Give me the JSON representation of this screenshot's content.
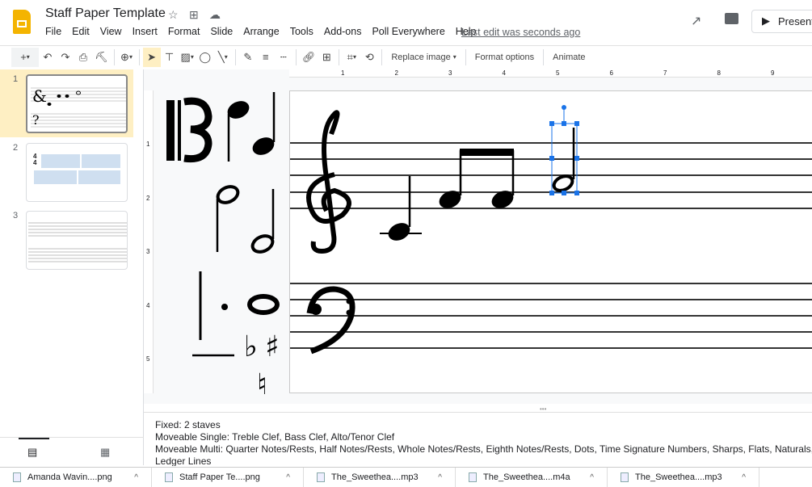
{
  "app": {
    "title": "Staff Paper Template",
    "icons": [
      "star-icon",
      "move-to-folder-icon",
      "cloud-saved-icon"
    ]
  },
  "menu": [
    "File",
    "Edit",
    "View",
    "Insert",
    "Format",
    "Slide",
    "Arrange",
    "Tools",
    "Add-ons",
    "Poll Everywhere",
    "Help"
  ],
  "last_edit": "Last edit was seconds ago",
  "header_right": {
    "present_label": "Present"
  },
  "toolbar": {
    "replace_image": "Replace image",
    "format_options": "Format options",
    "animate": "Animate"
  },
  "slides": [
    {
      "number": "1"
    },
    {
      "number": "2"
    },
    {
      "number": "3"
    }
  ],
  "ruler": {
    "top": [
      "1",
      "2",
      "3",
      "4",
      "5",
      "6",
      "7",
      "8",
      "9"
    ],
    "left": [
      "1",
      "2",
      "3",
      "4",
      "5"
    ]
  },
  "notes": [
    "Fixed:  2 staves",
    "Moveable Single:  Treble Clef, Bass Clef, Alto/Tenor Clef",
    "Moveable Multi:  Quarter Notes/Rests, Half Notes/Rests, Whole Notes/Rests, Eighth Notes/Rests, Dots, Time Signature Numbers, Sharps, Flats, Naturals,",
    "Ledger Lines"
  ],
  "downloads": [
    {
      "name": "Amanda Wavin....png"
    },
    {
      "name": "Staff Paper Te....png"
    },
    {
      "name": "The_Sweethea....mp3"
    },
    {
      "name": "The_Sweethea....m4a"
    },
    {
      "name": "The_Sweethea....mp3"
    }
  ],
  "colors": {
    "accent": "#f4b400",
    "selection": "#1a73e8",
    "selected_slide_bg": "#feefc3"
  }
}
